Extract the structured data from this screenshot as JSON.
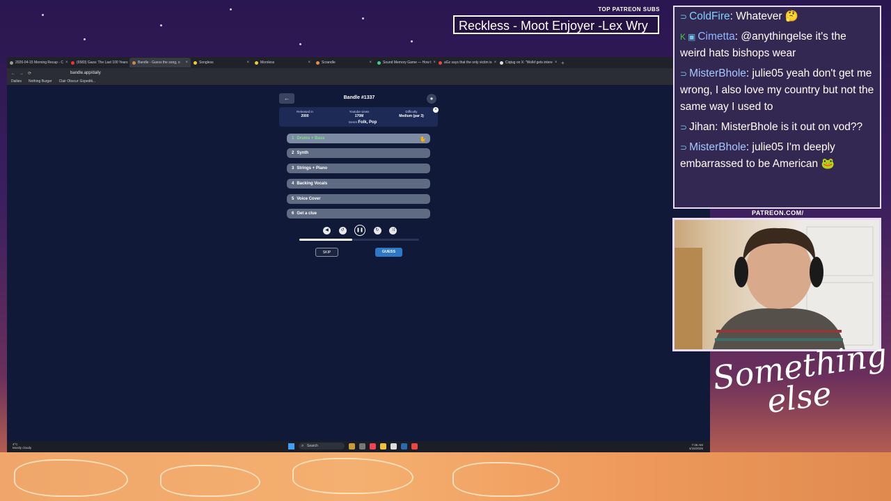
{
  "overlay": {
    "sub_title": "TOP PATREON SUBS",
    "sub_names": "Reckless - Moot Enjoyer -Lex Wry",
    "patreon_url": "PATREON.COM/",
    "logo_text": "Something else"
  },
  "browser": {
    "tabs": [
      {
        "label": "2026-04-15 Morning Recap - C"
      },
      {
        "label": "(6583) Gaza: The Last 100 Years"
      },
      {
        "label": "Bandle - Guess the song, o"
      },
      {
        "label": "Songless"
      },
      {
        "label": "Moroless"
      },
      {
        "label": "Scrandle"
      },
      {
        "label": "Sound Memory Game — How t"
      },
      {
        "label": "aGz says that the only victim is"
      },
      {
        "label": "Ciqtug on X: \"Wolkf gets intere"
      }
    ],
    "url": "bandle.app/daily",
    "bookmarks": [
      "Dailies",
      "Nothing Burger",
      "Clair Obscur: Expediti..."
    ]
  },
  "bandle": {
    "title": "Bandle #1337",
    "released_label": "Released in",
    "released_value": "2000",
    "views_label": "Youtube views",
    "views_value": "170M",
    "difficulty_label": "Difficulty",
    "difficulty_value": "Medium (par 3)",
    "genre_label": "Genre",
    "genre_value": "Folk, Pop",
    "clues": [
      {
        "num": "1",
        "label": "Drums + Bass"
      },
      {
        "num": "2",
        "label": "Synth"
      },
      {
        "num": "3",
        "label": "Strings + Piano"
      },
      {
        "num": "4",
        "label": "Backing Vocals"
      },
      {
        "num": "5",
        "label": "Voice Cover"
      },
      {
        "num": "6",
        "label": "Get a clue"
      }
    ],
    "progress": 0.44,
    "skip_label": "SKIP",
    "guess_label": "GUESS"
  },
  "taskbar": {
    "weather_temp": "4°C",
    "weather_desc": "Mostly cloudy",
    "search_placeholder": "Search",
    "time": "7:36 AM",
    "date": "4/15/2026"
  },
  "chat": [
    {
      "user": "ColdFire",
      "color": "#7fd0ff",
      "text": " Whatever"
    },
    {
      "user": "Cimetta",
      "color": "#8fb7ff",
      "text": " @anythingelse it's the weird hats bishops wear"
    },
    {
      "user": "MisterBhole",
      "color": "#a6c8ff",
      "text": " julie05 yeah don't get me wrong, I also love my country but not the same way I used to"
    },
    {
      "user": "Jihan",
      "color": "#ffffff",
      "text": " MisterBhole is it out on vod??"
    },
    {
      "user": "MisterBhole",
      "color": "#a6c8ff",
      "text": " julie05 I'm deeply embarrassed to be American"
    }
  ]
}
